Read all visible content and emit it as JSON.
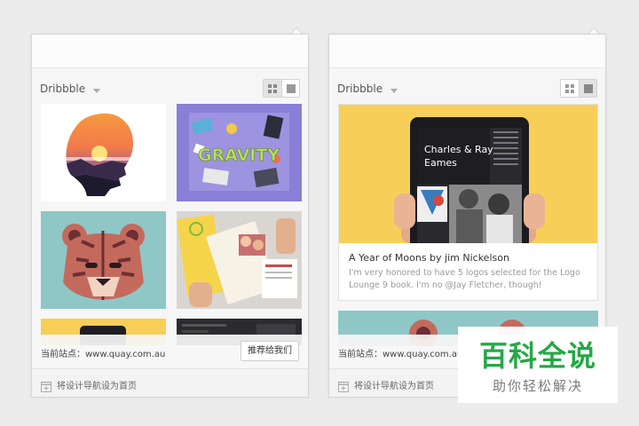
{
  "left_panel": {
    "source": "Dribbble",
    "view": "grid",
    "current_site_label": "当前站点：www.quay.com.au",
    "recommend_button": "推荐给我们",
    "set_home_label": "将设计导航设为首页",
    "thumbnails": [
      {
        "icon": "sunset-silhouette-shot"
      },
      {
        "icon": "gravity-desk-shot"
      },
      {
        "icon": "tiger-illustration-shot"
      },
      {
        "icon": "brochure-photo-shot"
      },
      {
        "icon": "phone-shot"
      },
      {
        "icon": "dark-ui-shot"
      }
    ],
    "gravity_text": "GRAVITY"
  },
  "right_panel": {
    "source": "Dribbble",
    "view": "list",
    "card": {
      "tablet_heading_line1": "Charles & Ray",
      "tablet_heading_line2": "Eames",
      "title": "A Year of Moons by jim Nickelson",
      "description": "I'm very honored to have 5 logos selected for the Logo Lounge 9 book. I'm no @Jay Fletcher, though!"
    },
    "current_site_label": "当前站点：www.quay.com.au",
    "set_home_label": "将设计导航设为首页"
  },
  "watermark": {
    "title": "百科全说",
    "subtitle": "助你轻松解决"
  },
  "colors": {
    "accent_green": "#25a845",
    "card_yellow": "#f7cf58",
    "teal": "#8fc7c6",
    "purple": "#8a7fd6"
  }
}
